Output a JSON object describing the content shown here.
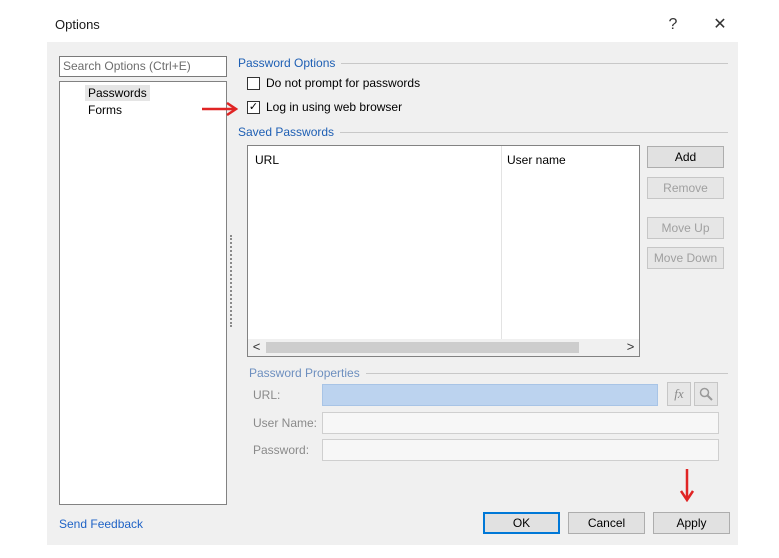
{
  "window": {
    "title": "Options",
    "help_glyph": "?",
    "close_glyph": "✕"
  },
  "sidebar": {
    "search_placeholder": "Search Options (Ctrl+E)",
    "items": [
      {
        "label": "Passwords",
        "selected": true
      },
      {
        "label": "Forms",
        "selected": false
      }
    ]
  },
  "password_options": {
    "header": "Password Options",
    "checkboxes": [
      {
        "label": "Do not prompt for passwords",
        "checked": false
      },
      {
        "label": "Log in using web browser",
        "checked": true
      }
    ]
  },
  "saved_passwords": {
    "header": "Saved Passwords",
    "columns": [
      "URL",
      "User name"
    ],
    "rows": [],
    "scroll_left": "<",
    "scroll_right": ">",
    "buttons": {
      "add": "Add",
      "remove": "Remove",
      "move_up": "Move Up",
      "move_down": "Move Down"
    }
  },
  "password_properties": {
    "header": "Password Properties",
    "url_label": "URL:",
    "user_label": "User Name:",
    "password_label": "Password:",
    "url_value": "",
    "user_value": "",
    "password_value": "",
    "fx_glyph": "fx",
    "search_icon": "magnifier-icon"
  },
  "footer": {
    "feedback_link": "Send Feedback",
    "ok": "OK",
    "cancel": "Cancel",
    "apply": "Apply"
  },
  "annotations": {
    "arrow_color": "#e02424",
    "right_arrow": "⟶",
    "down_arrow": "↓"
  },
  "colors": {
    "accent": "#0078d7",
    "group_header": "#1e5fb4",
    "link": "#1f63c6"
  }
}
